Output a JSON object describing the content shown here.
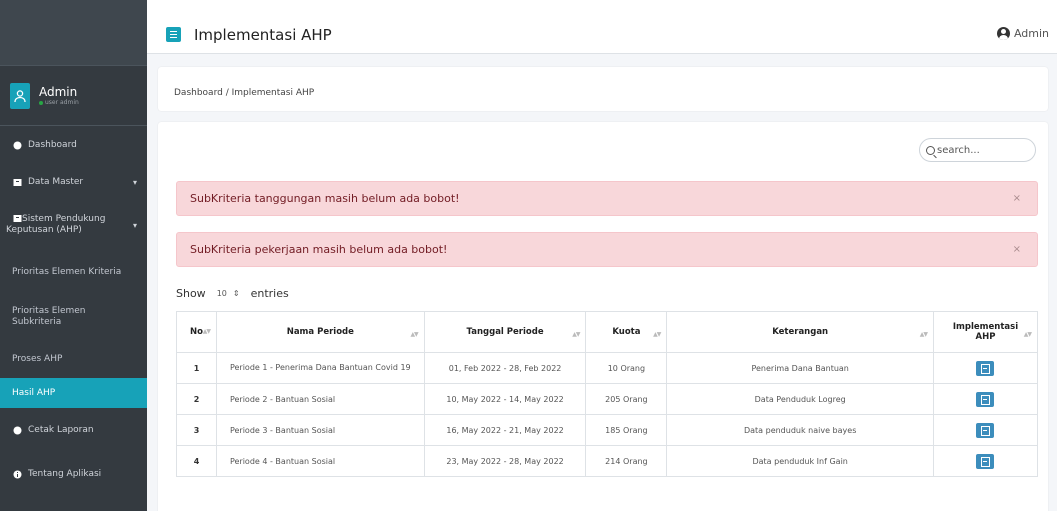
{
  "header": {
    "title": "Implementasi AHP",
    "user": "Admin"
  },
  "sidebar": {
    "user": {
      "name": "Admin",
      "role": "user admin"
    },
    "items": [
      {
        "label": "Dashboard"
      },
      {
        "label": "Data Master"
      },
      {
        "label": "Sistem Pendukung Keputusan (AHP)"
      }
    ],
    "subitems": [
      {
        "label": "Prioritas Elemen Kriteria"
      },
      {
        "label": "Prioritas Elemen Subkriteria"
      },
      {
        "label": "Proses AHP"
      },
      {
        "label": "Hasil AHP"
      }
    ],
    "bottom_items": [
      {
        "label": "Cetak Laporan"
      },
      {
        "label": "Tentang Aplikasi"
      }
    ],
    "active": "Hasil AHP"
  },
  "breadcrumb": "Dashboard / Implementasi AHP",
  "search": {
    "placeholder": "search..."
  },
  "alerts": [
    {
      "text": "SubKriteria tanggungan masih belum ada bobot!",
      "close": "×"
    },
    {
      "text": "SubKriteria pekerjaan masih belum ada bobot!",
      "close": "×"
    }
  ],
  "entries": {
    "show": "Show",
    "value": "10",
    "suffix": "entries"
  },
  "table": {
    "headers": [
      "No",
      "Nama Periode",
      "Tanggal Periode",
      "Kuota",
      "Keterangan",
      "Implementasi AHP"
    ],
    "rows": [
      {
        "no": "1",
        "nama": "Periode 1 - Penerima Dana Bantuan Covid 19",
        "tanggal": "01, Feb 2022 - 28, Feb 2022",
        "kuota": "10 Orang",
        "ket": "Penerima Dana Bantuan"
      },
      {
        "no": "2",
        "nama": "Periode 2 - Bantuan Sosial",
        "tanggal": "10, May 2022 - 14, May 2022",
        "kuota": "205 Orang",
        "ket": "Data Penduduk Logreg"
      },
      {
        "no": "3",
        "nama": "Periode 3 - Bantuan Sosial",
        "tanggal": "16, May 2022 - 21, May 2022",
        "kuota": "185 Orang",
        "ket": "Data penduduk naive bayes"
      },
      {
        "no": "4",
        "nama": "Periode 4 - Bantuan Sosial",
        "tanggal": "23, May 2022 - 28, May 2022",
        "kuota": "214 Orang",
        "ket": "Data penduduk Inf Gain"
      }
    ]
  }
}
